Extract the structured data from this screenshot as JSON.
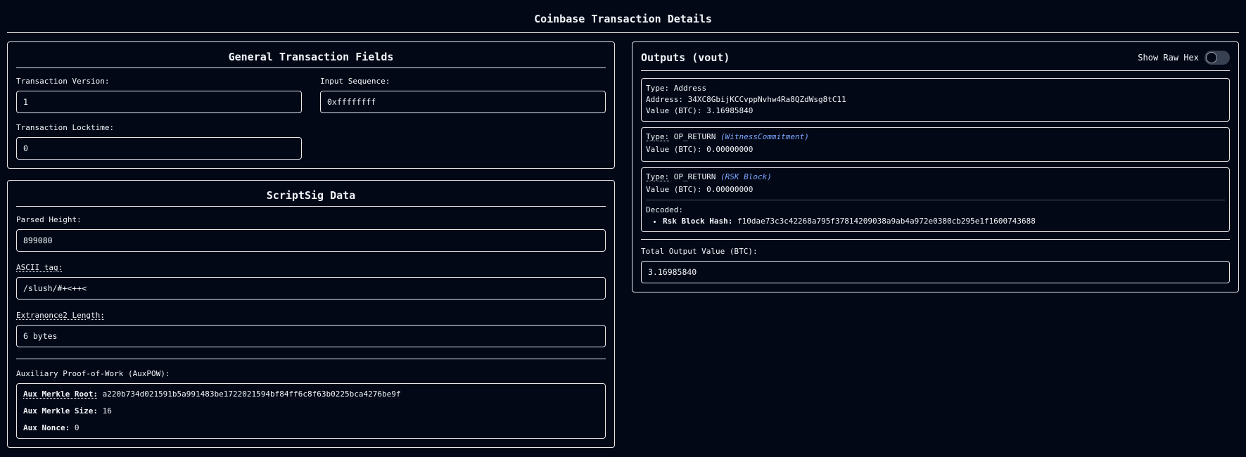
{
  "page": {
    "title": "Coinbase Transaction Details"
  },
  "general": {
    "title": "General Transaction Fields",
    "version_label": "Transaction Version:",
    "version_value": "1",
    "sequence_label": "Input Sequence:",
    "sequence_value": "0xffffffff",
    "locktime_label": "Transaction Locktime:",
    "locktime_value": "0"
  },
  "scriptsig": {
    "title": "ScriptSig Data",
    "height_label": "Parsed Height:",
    "height_value": "899080",
    "ascii_label": "ASCII tag:",
    "ascii_value": "/slush/#+<++<",
    "extranonce_label": "Extranonce2 Length:",
    "extranonce_value": "6 bytes",
    "auxpow_label": "Auxiliary Proof-of-Work (AuxPOW):",
    "aux_merkle_root_label": "Aux Merkle Root:",
    "aux_merkle_root_value": "a220b734d021591b5a991483be1722021594bf84ff6c8f63b0225bca4276be9f",
    "aux_merkle_size_label": "Aux Merkle Size:",
    "aux_merkle_size_value": "16",
    "aux_nonce_label": "Aux Nonce:",
    "aux_nonce_value": "0"
  },
  "outputs": {
    "title": "Outputs (vout)",
    "toggle_label": "Show Raw Hex",
    "toggle_on": false,
    "items": [
      {
        "type_label": "Type:",
        "type_value": "Address",
        "address_label": "Address:",
        "address_value": "34XC8GbijKCCvppNvhw4Ra8QZdWsg8tC11",
        "value_label": "Value (BTC):",
        "value": "3.16985840"
      },
      {
        "type_label": "Type:",
        "type_value": "OP_RETURN",
        "note": "(WitnessCommitment)",
        "value_label": "Value (BTC):",
        "value": "0.00000000"
      },
      {
        "type_label": "Type:",
        "type_value": "OP_RETURN",
        "note": "(RSK Block)",
        "value_label": "Value (BTC):",
        "value": "0.00000000",
        "decoded_label": "Decoded:",
        "decoded_key": "Rsk Block Hash:",
        "decoded_value": "f10dae73c3c42268a795f37814209038a9ab4a972e0380cb295e1f1600743688"
      }
    ],
    "total_label": "Total Output Value (BTC):",
    "total_value": "3.16985840"
  },
  "colors": {
    "background": "#030817",
    "text": "#f1f5f9",
    "border": "#e5e7eb",
    "accent_note": "#7aa7ff"
  }
}
